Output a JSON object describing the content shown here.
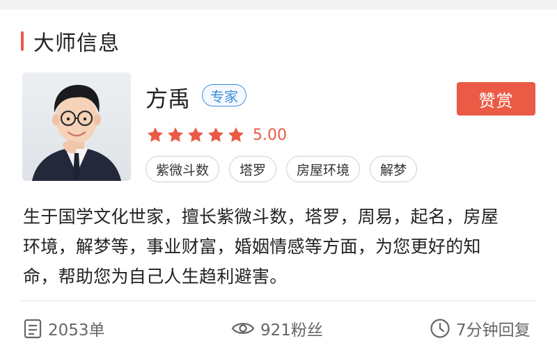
{
  "section": {
    "title": "大师信息"
  },
  "master": {
    "name": "方禹",
    "badge": "专家",
    "rating": 5.0,
    "rating_text": "5.00",
    "tags": [
      "紫微斗数",
      "塔罗",
      "房屋环境",
      "解梦"
    ],
    "bio_lines": [
      "生于国学文化世家，擅长紫微斗数，塔罗，周易，起名，房屋",
      "环境，解梦等，事业财富，婚姻情感等方面，为您更好的知",
      "命，帮助您为自己人生趋利避害。"
    ]
  },
  "actions": {
    "reward_label": "赞赏"
  },
  "stats": {
    "orders": {
      "icon": "document-list-icon",
      "text": "2053单"
    },
    "fans": {
      "icon": "eye-icon",
      "text": "921粉丝"
    },
    "reply": {
      "icon": "clock-icon",
      "text": "7分钟回复"
    }
  },
  "colors": {
    "accent": "#ea5a45",
    "badge_blue": "#3e8ed9",
    "muted": "#666666"
  }
}
